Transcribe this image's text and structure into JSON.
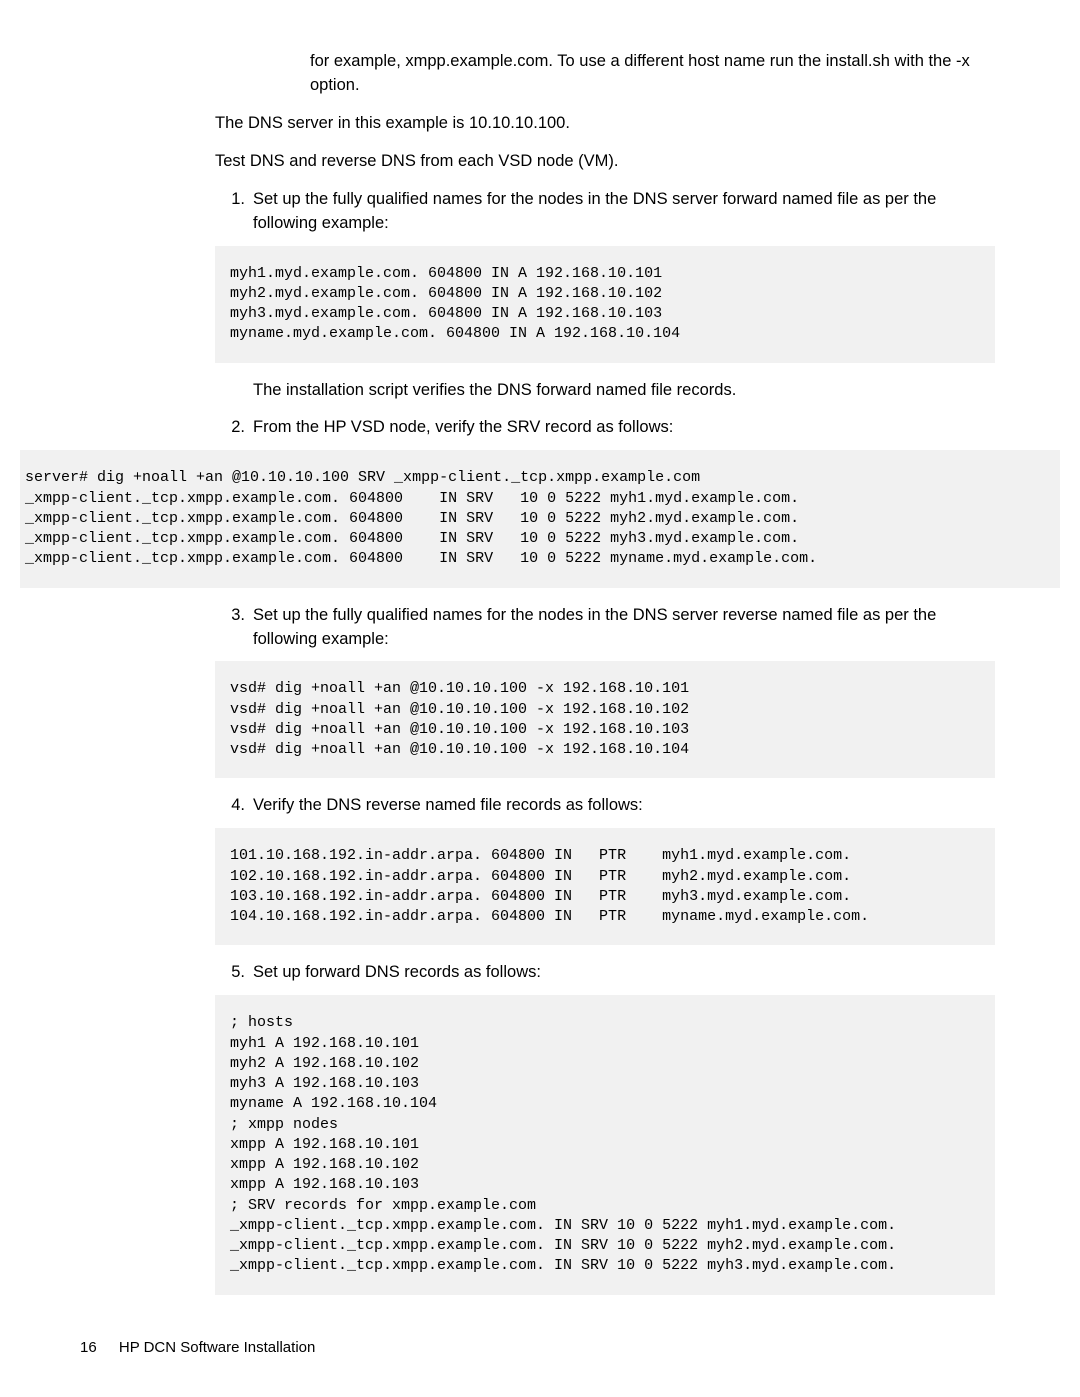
{
  "intro": {
    "line1": "for example, xmpp.example.com. To use a different host name run the install.sh with the -x option.",
    "line2": "The DNS server in this example is 10.10.10.100.",
    "line3": "Test DNS and reverse DNS from each VSD node (VM)."
  },
  "steps": {
    "s1": {
      "num": "1.",
      "text": "Set up the fully qualified names for the nodes in the DNS server forward named file as per the following example:"
    },
    "s2": {
      "num": "2.",
      "text": "From the HP VSD node, verify the SRV record as follows:"
    },
    "s3": {
      "num": "3.",
      "text": "Set up the fully qualified names for the nodes in the DNS server reverse named file as per the following example:"
    },
    "s4": {
      "num": "4.",
      "text": "Verify the DNS reverse named file records as follows:"
    },
    "s5": {
      "num": "5.",
      "text": "Set up forward DNS records as follows:"
    },
    "post1": "The installation script verifies the DNS forward named file records."
  },
  "code": {
    "c1": "myh1.myd.example.com. 604800 IN A 192.168.10.101\nmyh2.myd.example.com. 604800 IN A 192.168.10.102\nmyh3.myd.example.com. 604800 IN A 192.168.10.103\nmyname.myd.example.com. 604800 IN A 192.168.10.104",
    "c2": "server# dig +noall +an @10.10.10.100 SRV _xmpp-client._tcp.xmpp.example.com\n_xmpp-client._tcp.xmpp.example.com. 604800    IN SRV   10 0 5222 myh1.myd.example.com.\n_xmpp-client._tcp.xmpp.example.com. 604800    IN SRV   10 0 5222 myh2.myd.example.com.\n_xmpp-client._tcp.xmpp.example.com. 604800    IN SRV   10 0 5222 myh3.myd.example.com.\n_xmpp-client._tcp.xmpp.example.com. 604800    IN SRV   10 0 5222 myname.myd.example.com.",
    "c3": "vsd# dig +noall +an @10.10.10.100 -x 192.168.10.101\nvsd# dig +noall +an @10.10.10.100 -x 192.168.10.102\nvsd# dig +noall +an @10.10.10.100 -x 192.168.10.103\nvsd# dig +noall +an @10.10.10.100 -x 192.168.10.104",
    "c4": "101.10.168.192.in-addr.arpa. 604800 IN   PTR    myh1.myd.example.com.\n102.10.168.192.in-addr.arpa. 604800 IN   PTR    myh2.myd.example.com.\n103.10.168.192.in-addr.arpa. 604800 IN   PTR    myh3.myd.example.com.\n104.10.168.192.in-addr.arpa. 604800 IN   PTR    myname.myd.example.com.",
    "c5": "; hosts\nmyh1 A 192.168.10.101\nmyh2 A 192.168.10.102\nmyh3 A 192.168.10.103\nmyname A 192.168.10.104\n; xmpp nodes\nxmpp A 192.168.10.101\nxmpp A 192.168.10.102\nxmpp A 192.168.10.103\n; SRV records for xmpp.example.com\n_xmpp-client._tcp.xmpp.example.com. IN SRV 10 0 5222 myh1.myd.example.com.\n_xmpp-client._tcp.xmpp.example.com. IN SRV 10 0 5222 myh2.myd.example.com.\n_xmpp-client._tcp.xmpp.example.com. IN SRV 10 0 5222 myh3.myd.example.com."
  },
  "footer": {
    "page": "16",
    "title": "HP DCN Software Installation"
  }
}
